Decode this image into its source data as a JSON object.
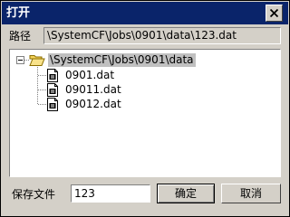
{
  "window": {
    "title": "打开",
    "close_icon": "close-x-icon"
  },
  "path": {
    "label": "路径",
    "value": "\\SystemCF\\Jobs\\0901\\data\\123.dat"
  },
  "tree": {
    "root": {
      "label": "\\SystemCF\\Jobs\\0901\\data",
      "icon": "open-folder-icon",
      "expanded": true,
      "selected": true
    },
    "files": [
      {
        "label": "0901.dat",
        "icon": "data-file-icon"
      },
      {
        "label": "09011.dat",
        "icon": "data-file-icon"
      },
      {
        "label": "09012.dat",
        "icon": "data-file-icon"
      }
    ]
  },
  "save": {
    "label": "保存文件",
    "value": "123"
  },
  "buttons": {
    "ok": "确定",
    "cancel": "取消"
  },
  "colors": {
    "titlebar": "#0a246a",
    "dialog_bg": "#d4d0c8",
    "folder": "#f5d35a",
    "selection": "#c0c0c0"
  }
}
